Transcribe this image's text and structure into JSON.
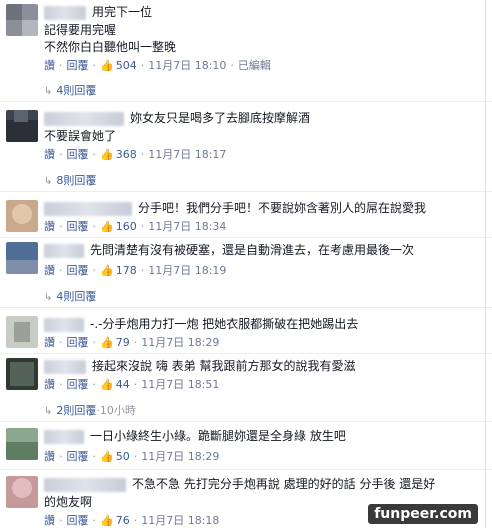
{
  "comments": [
    {
      "lines": [
        "用完下一位",
        "記得要用完喔",
        "不然你白白聽他叫一整晚"
      ],
      "like_label": "讚",
      "reply_label": "回覆",
      "likes": "504",
      "date": "11月7日 18:10",
      "edited": "已編輯",
      "replies": "4則回覆"
    },
    {
      "lines": [
        "妳女友只是喝多了去腳底按摩解酒",
        "不要誤會她了"
      ],
      "like_label": "讚",
      "reply_label": "回覆",
      "likes": "368",
      "date": "11月7日 18:17",
      "replies": "8則回覆"
    },
    {
      "lines": [
        "分手吧！我們分手吧！不要說妳含著別人的屌在說愛我"
      ],
      "like_label": "讚",
      "reply_label": "回覆",
      "likes": "160",
      "date": "11月7日 18:34"
    },
    {
      "lines": [
        "先問清楚有沒有被硬塞，還是自動滑進去，在考慮用最後一次"
      ],
      "like_label": "讚",
      "reply_label": "回覆",
      "likes": "178",
      "date": "11月7日 18:19",
      "replies": "4則回覆"
    },
    {
      "lines": [
        "-.-分手炮用力打一炮 把她衣服都撕破在把她踢出去"
      ],
      "like_label": "讚",
      "reply_label": "回覆",
      "likes": "79",
      "date": "11月7日 18:29"
    },
    {
      "lines": [
        "接起來沒說 嗨 表弟 幫我跟前方那女的說我有愛滋"
      ],
      "like_label": "讚",
      "reply_label": "回覆",
      "likes": "44",
      "date": "11月7日 18:51",
      "replies": "2則回覆",
      "replies_time": "10小時"
    },
    {
      "lines": [
        "一日小綠終生小綠。跪斷腿妳還是全身綠 放生吧"
      ],
      "like_label": "讚",
      "reply_label": "回覆",
      "likes": "50",
      "date": "11月7日 18:29"
    },
    {
      "lines": [
        "不急不急 先打完分手炮再說 處理的好的話 分手後 還是好",
        "的炮友啊"
      ],
      "like_label": "讚",
      "reply_label": "回覆",
      "likes": "76",
      "date": "11月7日 18:18"
    }
  ],
  "watermark": "funpeer.com",
  "colors": {
    "link": "#3b5998",
    "meta": "#6d7a95",
    "text": "#141823"
  },
  "icons": {
    "like": "thumbs-up-icon",
    "reply_arrow": "reply-arrow-icon"
  }
}
